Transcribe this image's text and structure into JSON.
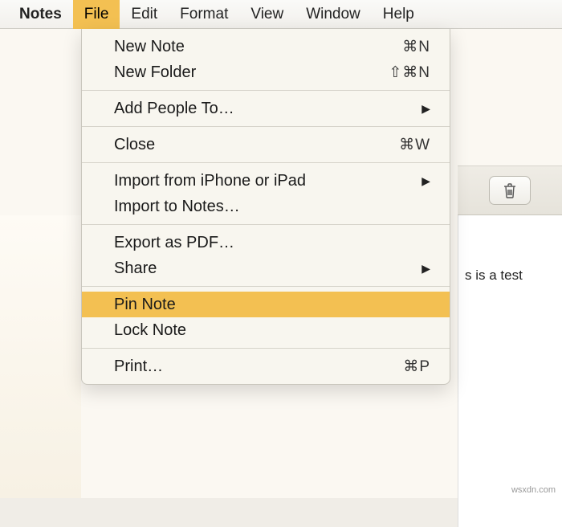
{
  "menubar": {
    "appname": "Notes",
    "items": [
      "File",
      "Edit",
      "Format",
      "View",
      "Window",
      "Help"
    ],
    "active": "File"
  },
  "dropdown": {
    "groups": [
      [
        {
          "label": "New Note",
          "shortcut": "⌘N"
        },
        {
          "label": "New Folder",
          "shortcut": "⇧⌘N"
        }
      ],
      [
        {
          "label": "Add People To…",
          "submenu": true
        }
      ],
      [
        {
          "label": "Close",
          "shortcut": "⌘W"
        }
      ],
      [
        {
          "label": "Import from iPhone or iPad",
          "submenu": true
        },
        {
          "label": "Import to Notes…"
        }
      ],
      [
        {
          "label": "Export as PDF…"
        },
        {
          "label": "Share",
          "submenu": true
        }
      ],
      [
        {
          "label": "Pin Note",
          "highlighted": true
        },
        {
          "label": "Lock Note"
        }
      ],
      [
        {
          "label": "Print…",
          "shortcut": "⌘P"
        }
      ]
    ]
  },
  "toolbar": {
    "trash_icon": "trash"
  },
  "content": {
    "visible_text": "s is a test"
  },
  "watermark": "wsxdn.com"
}
